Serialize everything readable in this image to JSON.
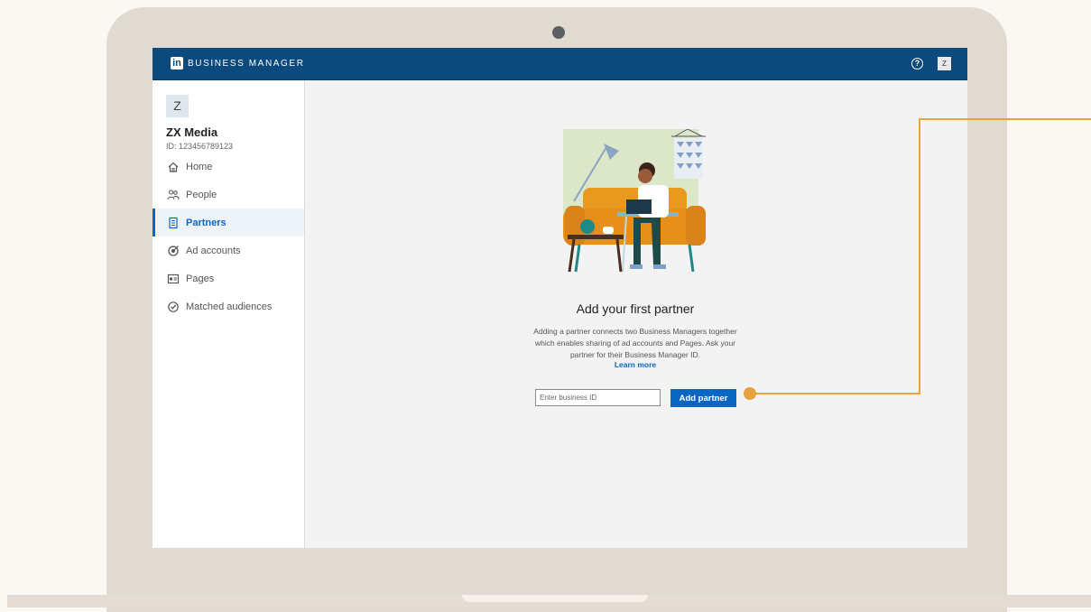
{
  "app": {
    "brand_logo": "in",
    "brand_title": "BUSINESS MANAGER",
    "help_icon": "help-icon",
    "user_initial": "Z"
  },
  "sidebar": {
    "org_initial": "Z",
    "org_name": "ZX Media",
    "org_id": "ID: 123456789123",
    "items": [
      {
        "label": "Home",
        "icon": "home-icon",
        "active": false
      },
      {
        "label": "People",
        "icon": "people-icon",
        "active": false
      },
      {
        "label": "Partners",
        "icon": "building-icon",
        "active": true
      },
      {
        "label": "Ad accounts",
        "icon": "target-icon",
        "active": false
      },
      {
        "label": "Pages",
        "icon": "page-icon",
        "active": false
      },
      {
        "label": "Matched audiences",
        "icon": "audience-icon",
        "active": false
      }
    ]
  },
  "main": {
    "title": "Add your first partner",
    "description": "Adding a partner connects two Business Managers together which enables sharing of ad accounts and Pages. Ask your partner for their Business Manager ID.",
    "learn_more": "Learn more",
    "input_placeholder": "Enter business ID",
    "input_value": "",
    "button_label": "Add partner"
  },
  "colors": {
    "topbar": "#0c4a7e",
    "accent": "#0a66c2",
    "callout": "#e8a23d",
    "laptop": "#e1dad0"
  }
}
